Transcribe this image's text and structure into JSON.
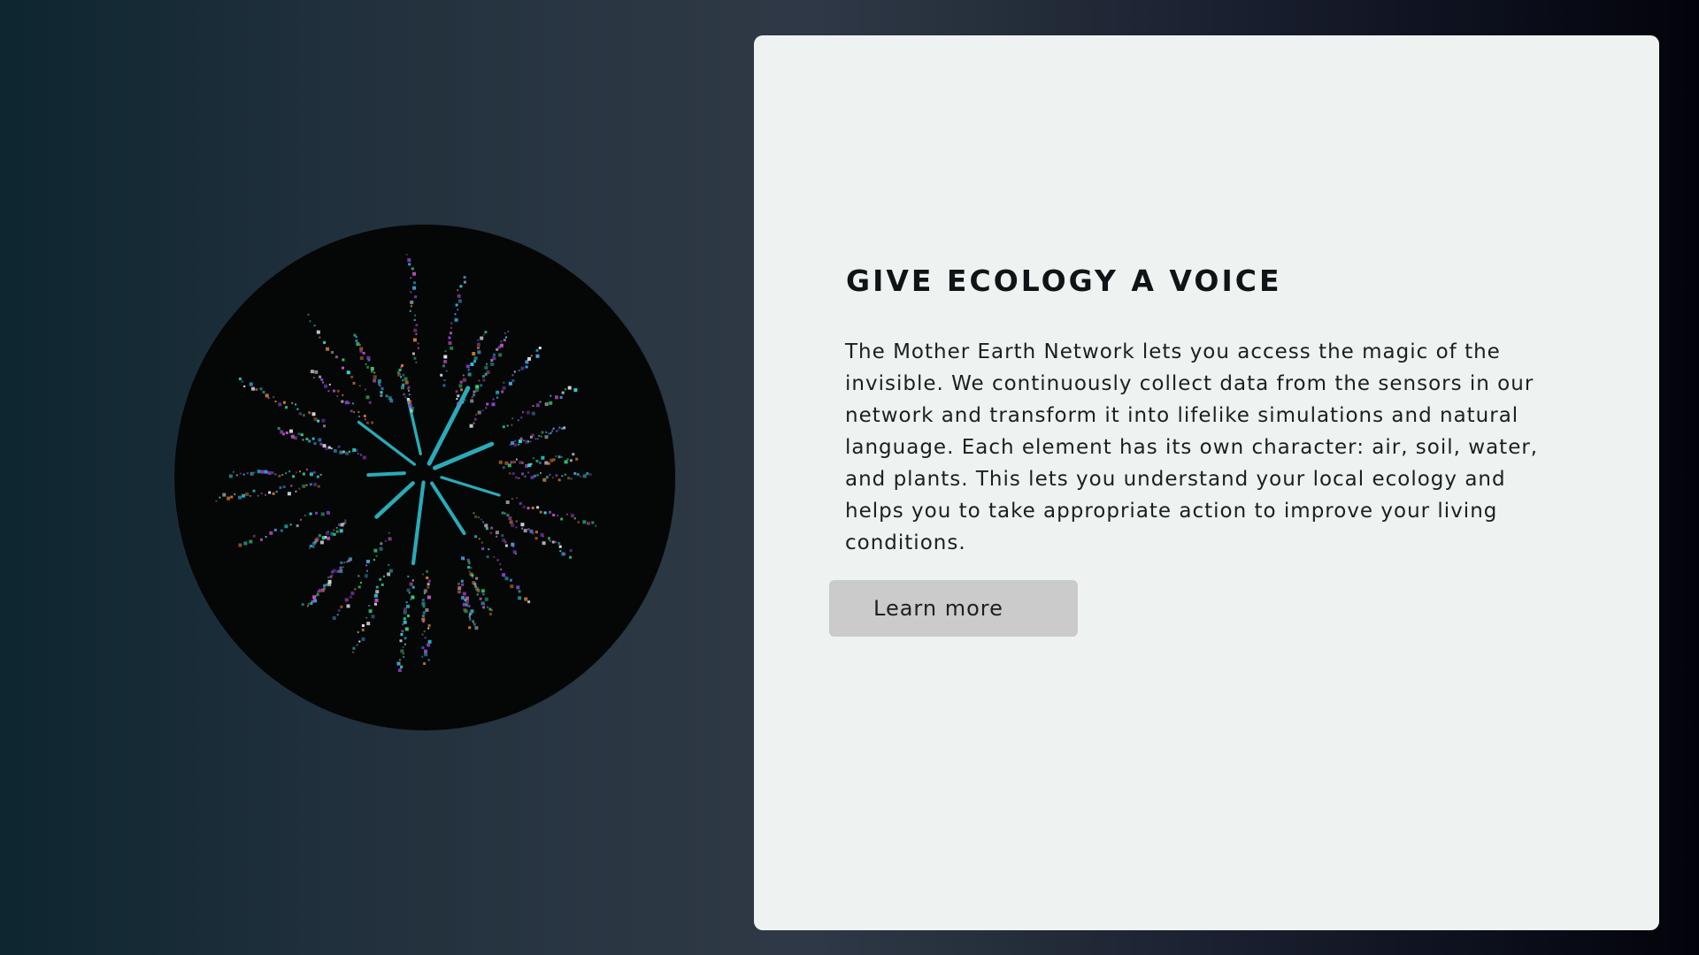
{
  "hero": {
    "visual": {
      "background": "#050606",
      "core_color": "#30c8d8",
      "particle_colors": [
        "#2fd3dc",
        "#34d07a",
        "#8a43d6",
        "#c254c7",
        "#e8e8f0",
        "#3fa0e0",
        "#d07a30"
      ]
    }
  },
  "content": {
    "headline": "GIVE ECOLOGY A VOICE",
    "body": "The Mother Earth Network lets you access the magic of the invisible. We continuously collect data from the sensors in our network and transform it into lifelike simulations and natural language. Each element has its own character: air, soil, water, and plants. This lets you understand your local ecology and helps you to take appropriate action to improve your living conditions.",
    "cta_label": "Learn more"
  },
  "colors": {
    "card_background": "#eef3f2",
    "button_background": "#cbcbcb",
    "text": "#111416"
  }
}
